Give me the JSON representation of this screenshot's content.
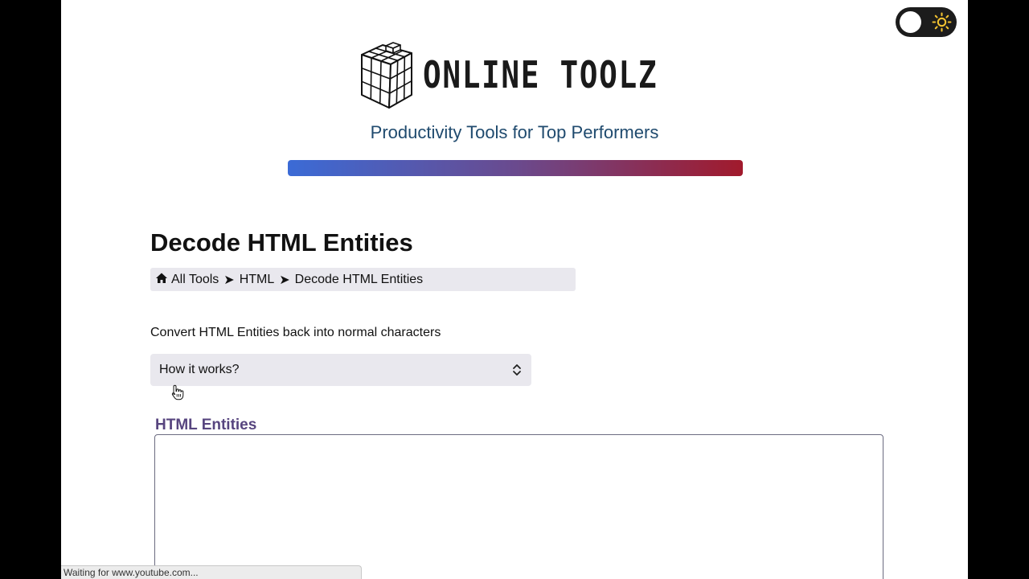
{
  "header": {
    "brand_name": "ONLINE TOOLZ",
    "tagline": "Productivity Tools for Top Performers",
    "logo_icon": "rubiks-cube-icon",
    "theme_toggle": {
      "state": "light",
      "icon": "sun-icon"
    },
    "gradient_colors": [
      "#3b6bd6",
      "#6a4a8e",
      "#a11a2c"
    ]
  },
  "main": {
    "title": "Decode HTML Entities",
    "breadcrumb": {
      "home_icon": "home-icon",
      "items": [
        "All Tools",
        "HTML",
        "Decode HTML Entities"
      ],
      "separator": "➤"
    },
    "description": "Convert HTML Entities back into normal characters",
    "how_it_works": {
      "label": "How it works?",
      "icon": "chevron-up-down-icon"
    },
    "input_field": {
      "label": "HTML Entities",
      "value": "",
      "accent_color": "#57457f"
    }
  },
  "browser": {
    "status_text": "Waiting for www.youtube.com..."
  }
}
